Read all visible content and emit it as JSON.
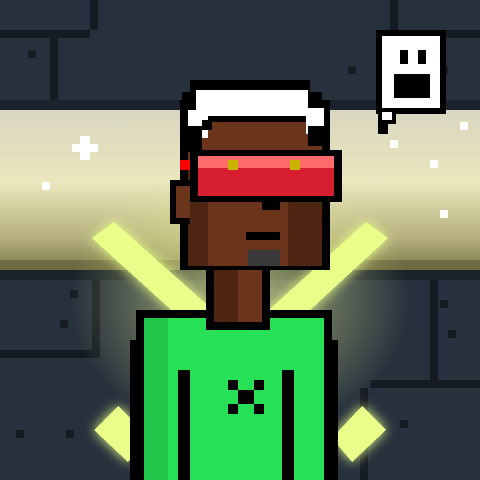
{
  "scene": {
    "type": "pixel-art-avatar",
    "palette": {
      "wall": "#26313d",
      "wall_dark": "#1a222c",
      "wall_line": "#151b23",
      "sky_top": "#d8d6c0",
      "sky_mid": "#ece7bd",
      "sky_bottom": "#8d8a53",
      "skin": "#6a351b",
      "skin_shadow": "#4f2513",
      "hair": "#ffffff",
      "hair_shadow": "#cfcfcf",
      "visor": "#d81f2f",
      "visor_light": "#ff6a6a",
      "shirt": "#26e055",
      "shirt_shadow": "#1aa840",
      "neon": "#e9ff8a",
      "neon_glow": "#c8ff2f",
      "outline": "#000000",
      "bubble_bg": "#ffffff"
    },
    "icons": {
      "speech_bubble": "smiley-face-speech-bubble-icon",
      "sparkle": "sparkle-icon",
      "shirt_mark": "x-mark-icon"
    }
  }
}
